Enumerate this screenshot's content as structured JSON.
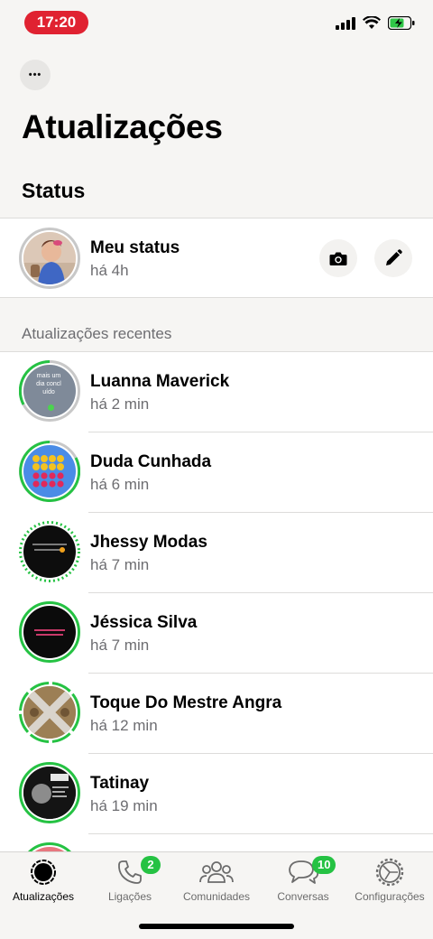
{
  "status_bar": {
    "time": "17:20"
  },
  "header": {
    "title": "Atualizações",
    "more_label": "•••"
  },
  "status_section": {
    "title": "Status"
  },
  "my_status": {
    "name": "Meu status",
    "time": "há 4h"
  },
  "recent": {
    "header": "Atualizações recentes",
    "items": [
      {
        "name": "Luanna Maverick",
        "time": "há 2 min",
        "thumb_text": "mais um dia concl uído"
      },
      {
        "name": "Duda Cunhada",
        "time": "há 6 min"
      },
      {
        "name": "Jhessy Modas",
        "time": "há 7 min"
      },
      {
        "name": "Jéssica Silva",
        "time": "há 7 min"
      },
      {
        "name": "Toque Do Mestre Angra",
        "time": "há 12 min"
      },
      {
        "name": "Tatinay",
        "time": "há 19 min"
      }
    ]
  },
  "tabs": [
    {
      "label": "Atualizações",
      "icon": "updates-icon",
      "active": true
    },
    {
      "label": "Ligações",
      "icon": "phone-icon",
      "badge": "2"
    },
    {
      "label": "Comunidades",
      "icon": "communities-icon"
    },
    {
      "label": "Conversas",
      "icon": "chat-icon",
      "badge": "10"
    },
    {
      "label": "Configurações",
      "icon": "settings-icon"
    }
  ],
  "colors": {
    "accent": "#25c243",
    "time_pill": "#e02231",
    "background": "#f6f5f3"
  }
}
